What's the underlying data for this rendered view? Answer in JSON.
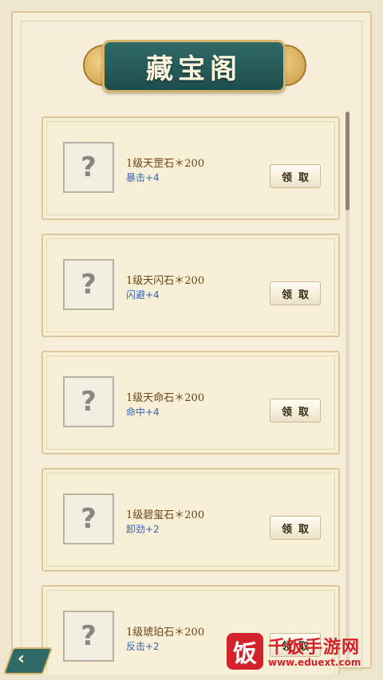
{
  "header": {
    "title": "藏宝阁"
  },
  "items": [
    {
      "name": "1级天罡石＊200",
      "stat": "暴击+4",
      "thumb_mark": "?",
      "button": "领取"
    },
    {
      "name": "1级天闪石＊200",
      "stat": "闪避+4",
      "thumb_mark": "?",
      "button": "领取"
    },
    {
      "name": "1级天命石＊200",
      "stat": "命中+4",
      "thumb_mark": "?",
      "button": "领取"
    },
    {
      "name": "1级碧玺石＊200",
      "stat": "卸劲+2",
      "thumb_mark": "?",
      "button": "领取"
    },
    {
      "name": "1级琥珀石＊200",
      "stat": "反击+2",
      "thumb_mark": "?",
      "button": "领取"
    }
  ],
  "back": {
    "icon": "back-arrow-icon",
    "glyph": "‹"
  },
  "watermark": {
    "logo_glyph": "饭",
    "title": "千饭手游网",
    "url": "www.eduext.com"
  },
  "colors": {
    "banner": "#2f6a67",
    "gold": "#d8b56a",
    "stat_blue": "#3a63b4",
    "name_brown": "#6b4316"
  }
}
